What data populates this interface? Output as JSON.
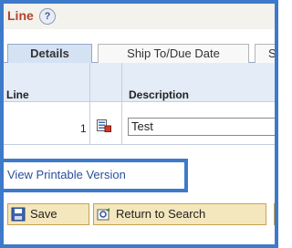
{
  "page": {
    "title": "Line",
    "help_symbol": "?"
  },
  "tabs": [
    {
      "label": "Details",
      "active": true
    },
    {
      "label": "Ship To/Due Date",
      "active": false
    },
    {
      "label": "S",
      "active": false
    }
  ],
  "grid": {
    "columns": [
      "Line",
      "",
      "Description"
    ],
    "rows": [
      {
        "line": "1",
        "description": "Test"
      }
    ]
  },
  "links": {
    "view_printable": "View Printable Version"
  },
  "toolbar": {
    "save_label": "Save",
    "return_label": "Return to Search"
  },
  "colors": {
    "highlight_border": "#3d7ac9",
    "title": "#b5422a",
    "link": "#2b4f9c",
    "button_bg": "#f4e6bd"
  }
}
